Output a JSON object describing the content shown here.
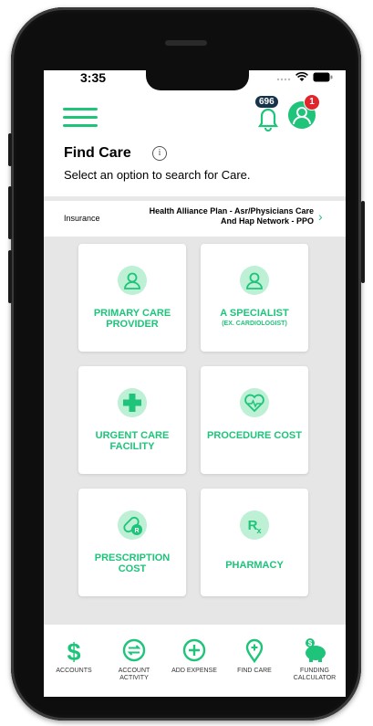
{
  "status_bar": {
    "time": "3:35"
  },
  "header": {
    "notification_count": "696",
    "profile_badge": "1"
  },
  "page": {
    "title": "Find Care",
    "subtitle": "Select an option to search for Care."
  },
  "insurance": {
    "label": "Insurance",
    "line1": "Health Alliance Plan - Asr/Physicians Care",
    "line2": "And Hap Network - PPO"
  },
  "cards": [
    {
      "title": "PRIMARY CARE PROVIDER",
      "sub": "",
      "icon": "person-icon"
    },
    {
      "title": "A SPECIALIST",
      "sub": "(EX. CARDIOLOGIST)",
      "icon": "person-icon"
    },
    {
      "title": "URGENT CARE FACILITY",
      "sub": "",
      "icon": "medical-cross-icon"
    },
    {
      "title": "PROCEDURE COST",
      "sub": "",
      "icon": "heart-pulse-icon"
    },
    {
      "title": "PRESCRIPTION COST",
      "sub": "",
      "icon": "pill-rx-icon"
    },
    {
      "title": "PHARMACY",
      "sub": "",
      "icon": "rx-icon"
    }
  ],
  "bottom_nav": [
    {
      "label": "ACCOUNTS",
      "icon": "dollar-icon"
    },
    {
      "label": "ACCOUNT ACTIVITY",
      "icon": "transfer-icon"
    },
    {
      "label": "ADD EXPENSE",
      "icon": "plus-circle-icon"
    },
    {
      "label": "FIND CARE",
      "icon": "location-pin-plus-icon"
    },
    {
      "label": "FUNDING CALCULATOR",
      "icon": "piggy-bank-icon"
    }
  ],
  "colors": {
    "accent": "#1ec47a",
    "accent_light": "#bdf0d5",
    "badge_dark": "#17324b",
    "badge_red": "#e0262c"
  }
}
